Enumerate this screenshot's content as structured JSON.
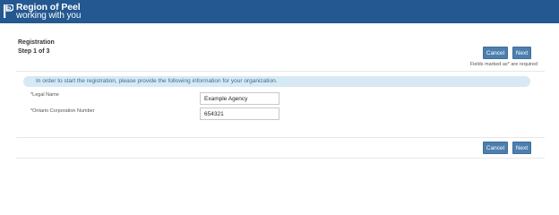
{
  "header": {
    "logo_line1": "Region of Peel",
    "logo_line2": "working with you",
    "background_color": "#245890",
    "logo_icon": "region-of-peel-logo-mark"
  },
  "page": {
    "title": "Registration",
    "step": "Step 1 of 3",
    "required_note": "Fields marked as* are required"
  },
  "buttons": {
    "cancel_label": "Cancel",
    "next_label": "Next",
    "color": "#4c7fae"
  },
  "info_banner": {
    "text": "In order to start the registration, please provide the following information for your organization.",
    "background_color": "#d7e9f4"
  },
  "form": {
    "legal_name": {
      "label": "*Legal Name",
      "value": "Example Agency"
    },
    "ontario_corp_number": {
      "label": "*Ontario Corporation Number",
      "value": "654321"
    }
  }
}
